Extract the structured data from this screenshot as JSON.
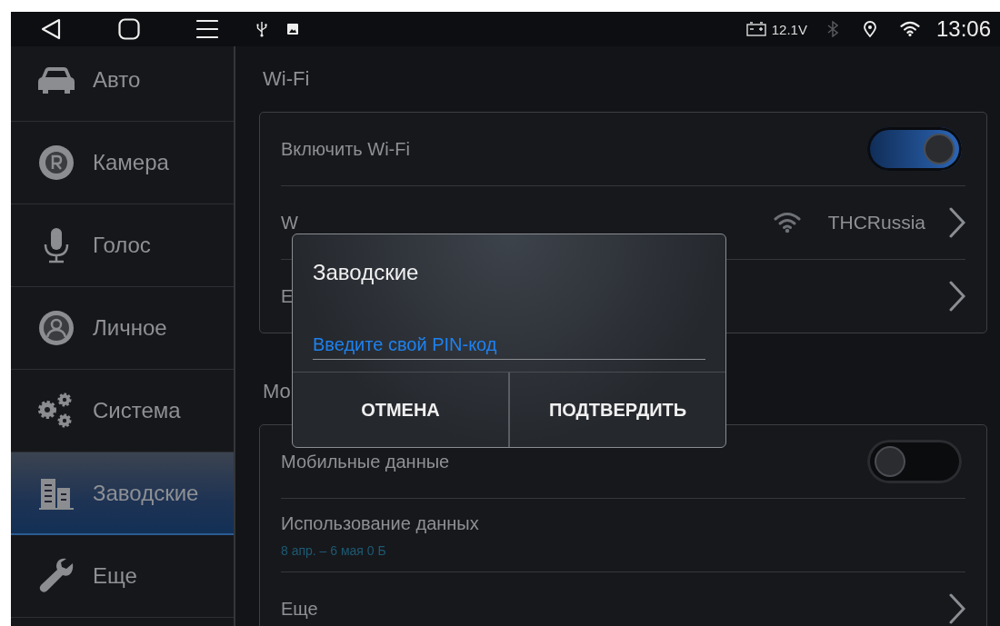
{
  "status_bar": {
    "voltage": "12.1V",
    "time": "13:06"
  },
  "sidebar": {
    "items": [
      {
        "label": "Авто",
        "selected": false
      },
      {
        "label": "Камера",
        "selected": false
      },
      {
        "label": "Голос",
        "selected": false
      },
      {
        "label": "Личное",
        "selected": false
      },
      {
        "label": "Система",
        "selected": false
      },
      {
        "label": "Заводские",
        "selected": true
      },
      {
        "label": "Еще",
        "selected": false
      }
    ]
  },
  "sections": [
    {
      "title": "Wi-Fi",
      "rows": [
        {
          "kind": "toggle",
          "label": "Включить Wi-Fi",
          "on": true
        },
        {
          "kind": "network",
          "label": "W",
          "value": "THCRussia"
        },
        {
          "kind": "link",
          "label": "E"
        }
      ]
    },
    {
      "title": "Мо",
      "rows": [
        {
          "kind": "toggle",
          "label": "Мобильные данные",
          "on": false
        },
        {
          "kind": "detail",
          "label": "Использование данных",
          "subtitle": "8 апр. – 6 мая 0 Б"
        },
        {
          "kind": "link",
          "label": "Еще"
        }
      ]
    }
  ],
  "dialog": {
    "title": "Заводские",
    "placeholder": "Введите свой PIN-код",
    "buttons": [
      "ОТМЕНА",
      "ПОДТВЕРДИТЬ"
    ]
  }
}
